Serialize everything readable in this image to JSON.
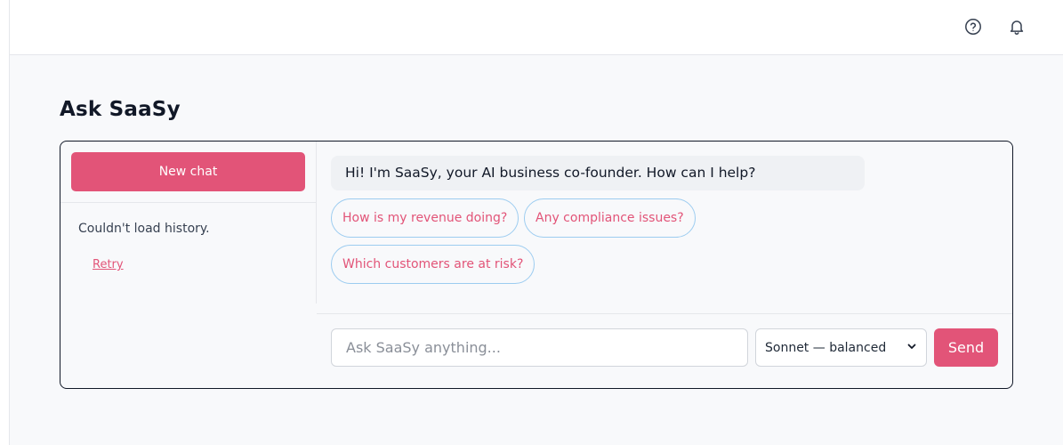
{
  "page": {
    "title": "Ask SaaSy"
  },
  "topbar": {
    "icons": [
      "help-circle-icon",
      "bell-icon"
    ]
  },
  "history": {
    "new_chat_label": "New chat",
    "error_text": "Couldn't load history.",
    "retry_label": "Retry"
  },
  "chat": {
    "greeting": "Hi! I'm SaaSy, your AI business co-founder. How can I help?",
    "suggestions": [
      "How is my revenue doing?",
      "Any compliance issues?",
      "Which customers are at risk?"
    ]
  },
  "composer": {
    "placeholder": "Ask SaaSy anything...",
    "model_selected": "Sonnet — balanced",
    "send_label": "Send"
  },
  "colors": {
    "accent": "#e25478",
    "chip_border": "#9cccf0",
    "background": "#f8f9fb"
  }
}
